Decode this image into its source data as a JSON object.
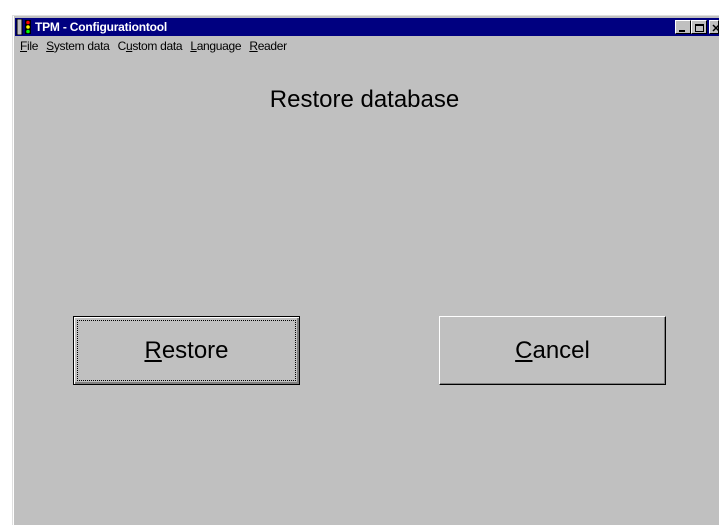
{
  "window": {
    "title": "TPM - Configurationtool"
  },
  "menubar": {
    "items": [
      {
        "first": "F",
        "rest": "ile"
      },
      {
        "first": "S",
        "rest": "ystem data"
      },
      {
        "pre": "C",
        "first": "u",
        "rest": "stom data"
      },
      {
        "first": "L",
        "rest": "anguage"
      },
      {
        "first": "R",
        "rest": "eader"
      }
    ]
  },
  "main": {
    "heading": "Restore database",
    "restore_button": {
      "first": "R",
      "rest": "estore"
    },
    "cancel_button": {
      "first": "C",
      "rest": "ancel"
    }
  },
  "colors": {
    "titlebar": "#000080",
    "face": "#c0c0c0"
  },
  "icons": [
    "traffic-light-icon",
    "minimize-icon",
    "maximize-icon",
    "close-icon"
  ]
}
